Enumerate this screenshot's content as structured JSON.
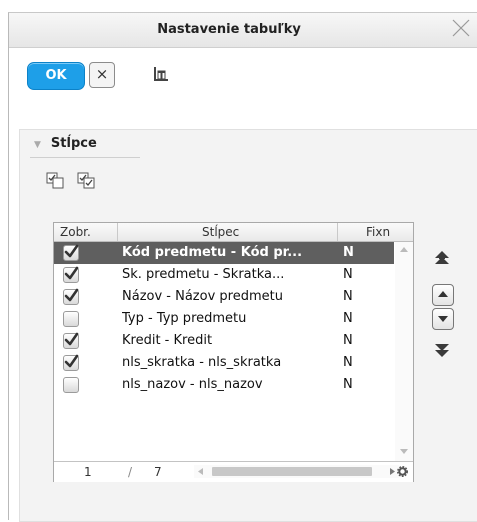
{
  "dialog": {
    "title": "Nastavenie tabuľky"
  },
  "toolbar": {
    "ok_label": "OK",
    "cancel_glyph": "×",
    "columns_icon": "grid-columns-icon"
  },
  "section": {
    "title": "Stĺpce",
    "toggle_icon": "triangle-down-icon"
  },
  "select_icons": [
    "select-all-icon",
    "invert-selection-icon"
  ],
  "grid": {
    "headers": [
      "Zobr.",
      "Stĺpec",
      "Fixn"
    ],
    "rows": [
      {
        "shown": true,
        "name": "Kód predmetu - Kód pr...",
        "fixed": "N",
        "selected": true
      },
      {
        "shown": true,
        "name": "Sk. predmetu - Skratka...",
        "fixed": "N",
        "selected": false
      },
      {
        "shown": true,
        "name": "Názov - Názov predmetu",
        "fixed": "N",
        "selected": false
      },
      {
        "shown": false,
        "name": "Typ - Typ predmetu",
        "fixed": "N",
        "selected": false
      },
      {
        "shown": true,
        "name": "Kredit - Kredit",
        "fixed": "N",
        "selected": false
      },
      {
        "shown": true,
        "name": "nls_skratka - nls_skratka",
        "fixed": "N",
        "selected": false
      },
      {
        "shown": false,
        "name": "nls_nazov - nls_nazov",
        "fixed": "N",
        "selected": false
      }
    ],
    "footer": {
      "page": "1",
      "separator": "/",
      "total": "7"
    }
  },
  "move_buttons": [
    "move-top-icon",
    "move-up-icon",
    "move-down-icon",
    "move-bottom-icon"
  ],
  "colors": {
    "accent": "#1e9fe8",
    "selected_row": "#5f5f5f",
    "panel_bg": "#f3f3f3"
  }
}
